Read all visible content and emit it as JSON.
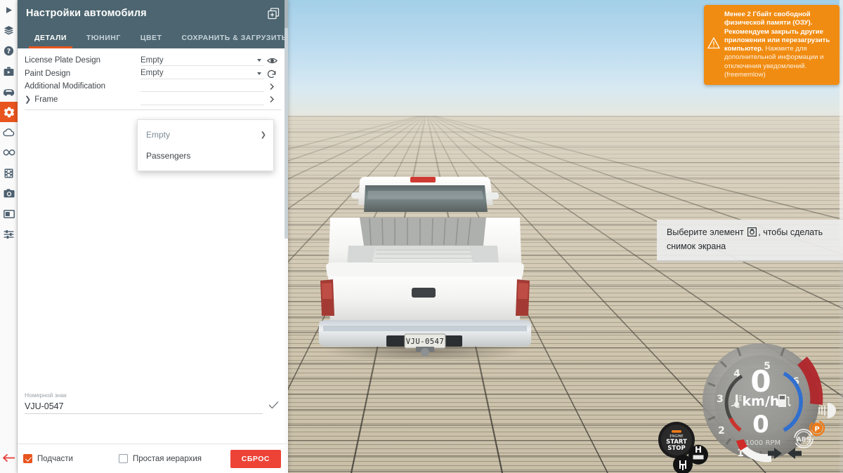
{
  "app": {
    "panel_title": "Настройки автомобиля",
    "header_icon": "new-window-icon"
  },
  "sidebar": {
    "items": [
      {
        "name": "play-icon",
        "label": "play"
      },
      {
        "name": "layers-icon",
        "label": "layers"
      },
      {
        "name": "help-icon",
        "label": "help"
      },
      {
        "name": "briefcase-play-icon",
        "label": "scenarios"
      },
      {
        "name": "car-icon",
        "label": "vehicle"
      },
      {
        "name": "gear-icon",
        "label": "vehicle-config",
        "active": true
      },
      {
        "name": "cloud-icon",
        "label": "environment"
      },
      {
        "name": "infinity-icon",
        "label": "simulation"
      },
      {
        "name": "film-icon",
        "label": "replay"
      },
      {
        "name": "camera-icon",
        "label": "camera"
      },
      {
        "name": "window-icon",
        "label": "ui-layout"
      },
      {
        "name": "sliders-icon",
        "label": "settings"
      }
    ],
    "back_icon": "back-arrow-icon"
  },
  "tabs": [
    {
      "label": "ДЕТАЛИ",
      "active": true
    },
    {
      "label": "ТЮНИНГ",
      "active": false
    },
    {
      "label": "ЦВЕТ",
      "active": false
    },
    {
      "label": "СОХРАНИТЬ & ЗАГРУЗИТЬ",
      "active": false
    }
  ],
  "rows": [
    {
      "label": "License Plate Design",
      "value": "Empty",
      "icon": "eye-icon",
      "type": "select"
    },
    {
      "label": "Paint Design",
      "value": "Empty",
      "icon": "refresh-icon",
      "type": "select"
    },
    {
      "label": "Additional Modification",
      "value": "",
      "icon": "chevron-right-icon",
      "type": "select"
    },
    {
      "label": "Frame",
      "value": "",
      "icon": "chevron-right-icon",
      "type": "group"
    }
  ],
  "dropdown": {
    "open": true,
    "items": [
      {
        "label": "Empty",
        "selected": true,
        "has_submenu": true
      },
      {
        "label": "Passengers",
        "selected": false,
        "has_submenu": false
      }
    ]
  },
  "plate_field": {
    "caption": "Номерной знак",
    "value": "VJU-0547",
    "confirm_icon": "check-icon"
  },
  "footer": {
    "checkbox_subparts": {
      "label": "Подчасти",
      "checked": true
    },
    "checkbox_simple_hierarchy": {
      "label": "Простая иерархия",
      "checked": false
    },
    "reset_button": "СБРОС"
  },
  "notifications": {
    "warning": {
      "icon": "warning-triangle-icon",
      "bold_text": "Менее 2 Гбайт свободной физической памяти (ОЗУ). Рекомендуем закрыть другие приложения или перезагрузить компьютер.",
      "dim_text": "Нажмите для дополнительной информации и отключения уведомлений. (freememlow)"
    },
    "hint": {
      "text_before": "Выберите элемент",
      "icon": "screenshot-icon",
      "text_after": ", чтобы сделать снимок экрана"
    }
  },
  "vehicle": {
    "license_plate": "VJU-0547",
    "body_color": "#f2f2f0"
  },
  "hud": {
    "speed": "0",
    "speed_unit": "km/h",
    "gear": "0",
    "rpm_label": "x1000 RPM",
    "rpm_ticks": [
      "1",
      "2",
      "3",
      "4",
      "5",
      "6"
    ],
    "engine_button": {
      "line1": "ENGINE",
      "line2": "START",
      "line3": "STOP"
    },
    "indicators": [
      {
        "name": "parking-brake-indicator",
        "label": "P"
      },
      {
        "name": "abs-indicator",
        "label": "ABS"
      },
      {
        "name": "headlight-indicator",
        "label": ""
      },
      {
        "name": "turn-left-indicator",
        "label": ""
      },
      {
        "name": "turn-right-indicator",
        "label": ""
      },
      {
        "name": "hazard-indicator",
        "label": "H"
      },
      {
        "name": "shifter-indicator",
        "label": ""
      },
      {
        "name": "coolant-temp-indicator",
        "label": ""
      },
      {
        "name": "fuel-indicator",
        "label": ""
      }
    ],
    "accent_colors": {
      "fuel": "#2f6fd0",
      "temp": "#c8342e",
      "redline": "#b0252a"
    }
  },
  "colors": {
    "panel_header": "#4c6570",
    "accent": "#e8551f",
    "reset": "#ed4337",
    "warning": "#f18c12"
  }
}
